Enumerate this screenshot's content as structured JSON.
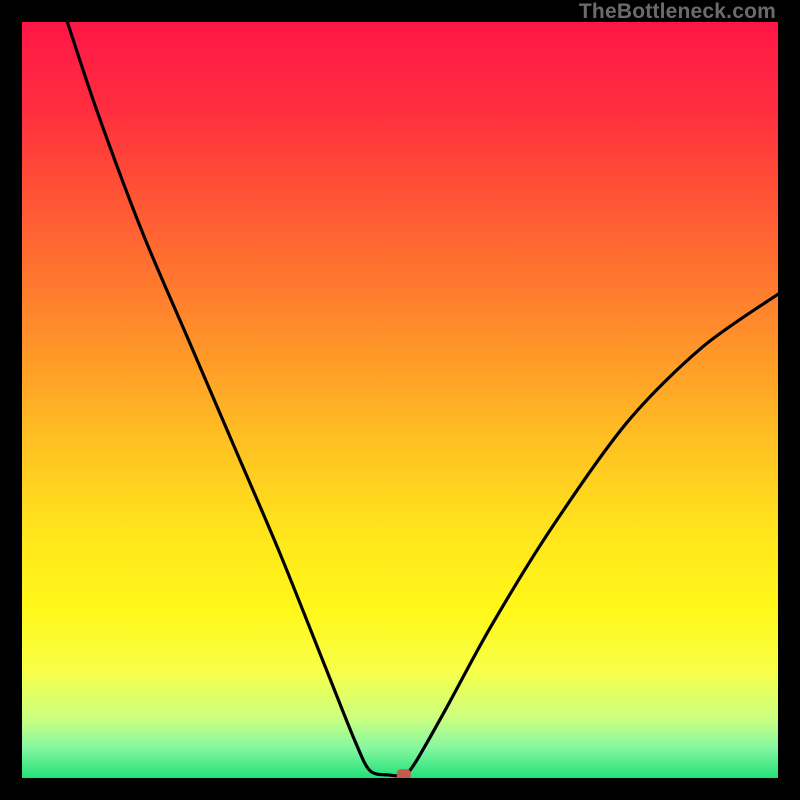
{
  "watermark": "TheBottleneck.com",
  "chart_data": {
    "type": "line",
    "title": "",
    "xlabel": "",
    "ylabel": "",
    "xlim": [
      0,
      100
    ],
    "ylim": [
      0,
      100
    ],
    "background_gradient": {
      "stops": [
        {
          "offset": 0.0,
          "color": "#ff1647"
        },
        {
          "offset": 0.12,
          "color": "#ff2f3e"
        },
        {
          "offset": 0.25,
          "color": "#ff5a34"
        },
        {
          "offset": 0.4,
          "color": "#ff8a2b"
        },
        {
          "offset": 0.55,
          "color": "#ffbf22"
        },
        {
          "offset": 0.68,
          "color": "#ffe61c"
        },
        {
          "offset": 0.78,
          "color": "#fff81a"
        },
        {
          "offset": 0.86,
          "color": "#f7ff4a"
        },
        {
          "offset": 0.92,
          "color": "#ccff80"
        },
        {
          "offset": 0.96,
          "color": "#85f7a0"
        },
        {
          "offset": 1.0,
          "color": "#22e07a"
        }
      ]
    },
    "curve": {
      "description": "V-shaped bottleneck curve with minimum near x≈48",
      "points": [
        {
          "x": 6.0,
          "y": 100.0
        },
        {
          "x": 10.0,
          "y": 88.0
        },
        {
          "x": 16.0,
          "y": 72.0
        },
        {
          "x": 22.0,
          "y": 58.0
        },
        {
          "x": 28.0,
          "y": 44.0
        },
        {
          "x": 34.0,
          "y": 30.0
        },
        {
          "x": 40.0,
          "y": 15.0
        },
        {
          "x": 44.0,
          "y": 5.0
        },
        {
          "x": 46.0,
          "y": 1.0
        },
        {
          "x": 48.5,
          "y": 0.4
        },
        {
          "x": 50.5,
          "y": 0.4
        },
        {
          "x": 52.0,
          "y": 2.0
        },
        {
          "x": 56.0,
          "y": 9.0
        },
        {
          "x": 62.0,
          "y": 20.0
        },
        {
          "x": 70.0,
          "y": 33.0
        },
        {
          "x": 80.0,
          "y": 47.0
        },
        {
          "x": 90.0,
          "y": 57.0
        },
        {
          "x": 100.0,
          "y": 64.0
        }
      ]
    },
    "marker": {
      "x": 50.5,
      "y": 0.5,
      "color": "#c65a4f"
    }
  }
}
